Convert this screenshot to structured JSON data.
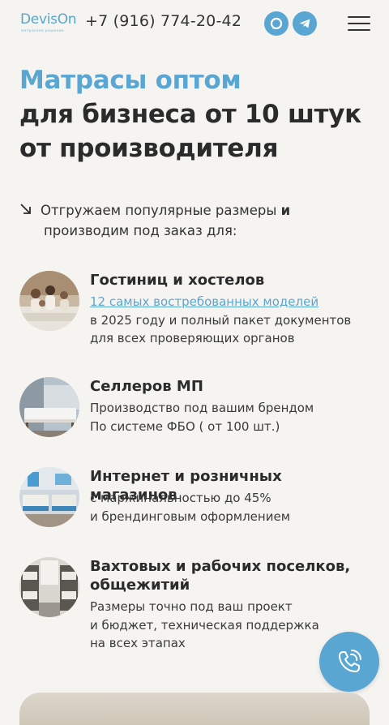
{
  "header": {
    "logo_text": "DevisOn",
    "logo_sub": "матрасное решение",
    "phone": "+7 (916) 774-20-42",
    "social": [
      {
        "icon": "max-icon",
        "color": "#5aa6d3"
      },
      {
        "icon": "telegram-icon",
        "color": "#5aa6d3"
      }
    ],
    "menu_icon": "burger-menu-icon"
  },
  "hero": {
    "title_accent": "Матрасы оптом",
    "title_line2": "для бизнеса от 10 штук",
    "title_line3": "от производителя"
  },
  "intro": {
    "line1_regular": "Отгружаем популярные размеры ",
    "line1_bold": "и",
    "line2": "производим под заказ для:"
  },
  "segments": [
    {
      "title": "Гостиниц и хостелов",
      "link": "12 самых востребованных моделей",
      "lines": [
        "в 2025 году и полный пакет документов",
        "для всех проверяющих органов"
      ]
    },
    {
      "title": "Селлеров МП",
      "lines": [
        "Производство под вашим брендом",
        "По системе ФБО ( от 100 шт.)"
      ]
    },
    {
      "title": "Интернет и розничных магазинов",
      "lines": [
        "с маржинальностью до 45%",
        "и брендинговым оформлением"
      ]
    },
    {
      "title_line1": "Вахтовых и рабочих поселков,",
      "title_line2": "общежитий",
      "lines": [
        "Размеры точно под ваш проект",
        "и бюджет, техническая поддержка",
        "на всех этапах"
      ]
    }
  ],
  "colors": {
    "accent": "#5aa6d3",
    "background": "#f5f4f1",
    "text": "#2b2b2b"
  },
  "call_button_icon": "phone-call-icon"
}
